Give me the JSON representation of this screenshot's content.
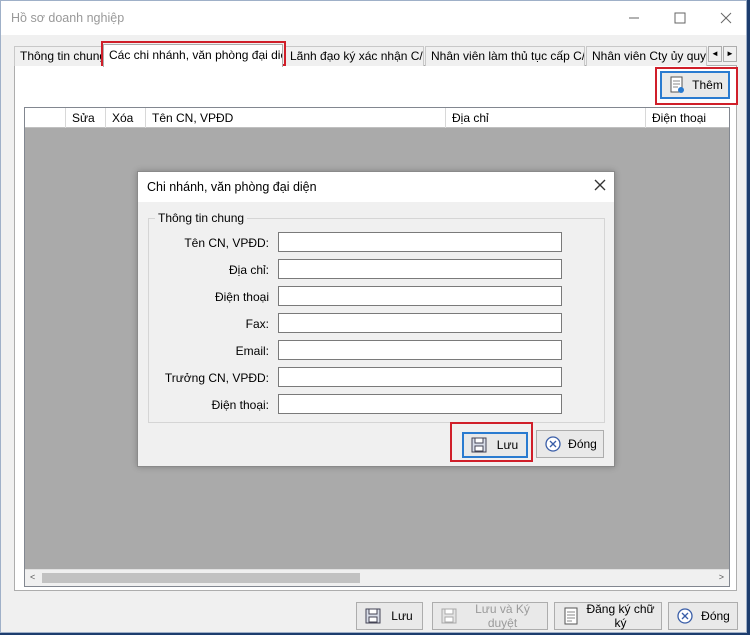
{
  "window": {
    "title": "Hồ sơ doanh nghiệp",
    "minimize_icon": "minimize-icon",
    "maximize_icon": "maximize-icon",
    "close_icon": "close-icon"
  },
  "tabs": [
    {
      "label": "Thông tin chung",
      "active": false
    },
    {
      "label": "Các chi nhánh, văn phòng đại diện",
      "active": true
    },
    {
      "label": "Lãnh đạo ký xác nhận C/O",
      "active": false
    },
    {
      "label": "Nhân viên làm thủ tục cấp C/O",
      "active": false
    },
    {
      "label": "Nhân viên Cty ủy quyền",
      "active": false
    }
  ],
  "tab_scroll": {
    "left": "◄",
    "right": "►"
  },
  "toolbar": {
    "add_label": "Thêm",
    "add_icon": "add-document-icon"
  },
  "grid": {
    "columns": [
      "",
      "Sửa",
      "Xóa",
      "Tên CN, VPĐD",
      "Địa chỉ",
      "Điện thoại"
    ],
    "scroll_left": "<",
    "scroll_right": ">"
  },
  "dialog": {
    "title": "Chi nhánh, văn phòng đại diện",
    "group_title": "Thông tin chung",
    "fields": [
      {
        "label": "Tên CN, VPĐD:",
        "value": ""
      },
      {
        "label": "Địa chỉ:",
        "value": ""
      },
      {
        "label": "Điện thoại",
        "value": ""
      },
      {
        "label": "Fax:",
        "value": ""
      },
      {
        "label": "Email:",
        "value": ""
      },
      {
        "label": "Trưởng CN, VPĐD:",
        "value": ""
      },
      {
        "label": "Điện thoại:",
        "value": ""
      }
    ],
    "save_label": "Lưu",
    "close_label": "Đóng"
  },
  "footer": {
    "save_label": "Lưu",
    "save_approve_label": "Lưu và Ký duyệt",
    "register_signature_label": "Đăng ký chữ ký",
    "close_label": "Đóng"
  },
  "colors": {
    "highlight": "#d01f2a",
    "focus_border": "#2a7bd0",
    "grid_bg": "#aaaaaa"
  }
}
